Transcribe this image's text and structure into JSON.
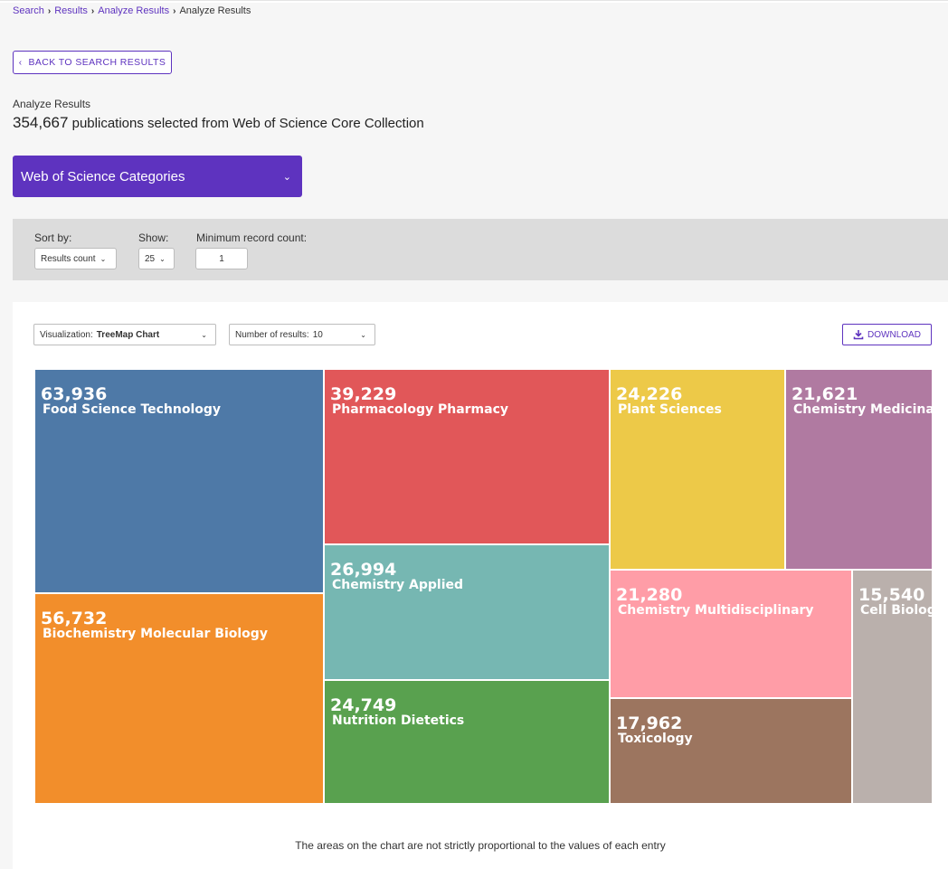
{
  "breadcrumb": {
    "items": [
      "Search",
      "Results",
      "Analyze Results"
    ],
    "current": "Analyze Results"
  },
  "back_button": {
    "label": "BACK TO SEARCH RESULTS"
  },
  "header": {
    "label": "Analyze Results",
    "count": "354,667",
    "description": "publications selected from Web of Science Core Collection"
  },
  "field_select": {
    "value": "Web of Science Categories"
  },
  "filters": {
    "sort_label": "Sort by:",
    "sort_value": "Results count",
    "show_label": "Show:",
    "show_value": "25",
    "min_label": "Minimum record count:",
    "min_value": "1"
  },
  "chart_controls": {
    "visualization_label": "Visualization:",
    "visualization_value": "TreeMap Chart",
    "results_label": "Number of results:",
    "results_value": "10",
    "download_label": "DOWNLOAD"
  },
  "chart_data": {
    "type": "treemap",
    "items": [
      {
        "label": "Food Science Technology",
        "value": 63936,
        "display": "63,936",
        "color": "#4e79a7"
      },
      {
        "label": "Biochemistry Molecular Biology",
        "value": 56732,
        "display": "56,732",
        "color": "#f28e2b"
      },
      {
        "label": "Pharmacology Pharmacy",
        "value": 39229,
        "display": "39,229",
        "color": "#e15759"
      },
      {
        "label": "Chemistry Applied",
        "value": 26994,
        "display": "26,994",
        "color": "#76b7b2"
      },
      {
        "label": "Nutrition Dietetics",
        "value": 24749,
        "display": "24,749",
        "color": "#59a14f"
      },
      {
        "label": "Plant Sciences",
        "value": 24226,
        "display": "24,226",
        "color": "#edc948"
      },
      {
        "label": "Chemistry Medicinal",
        "value": 21621,
        "display": "21,621",
        "color": "#b07aa1"
      },
      {
        "label": "Chemistry Multidisciplinary",
        "value": 21280,
        "display": "21,280",
        "color": "#ff9da7"
      },
      {
        "label": "Toxicology",
        "value": 17962,
        "display": "17,962",
        "color": "#9c755f"
      },
      {
        "label": "Cell Biology",
        "value": 15540,
        "display": "15,540",
        "color": "#bab0ac"
      }
    ]
  },
  "footnote": "The areas on the chart are not strictly proportional to the values of each entry"
}
